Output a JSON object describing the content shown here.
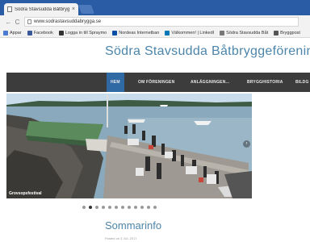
{
  "browser": {
    "tab_title": "Södra Stavsudda Båtbryg",
    "tab_close": "×",
    "url": "www.sodrastavsuddabrygga.se",
    "bookmarks": [
      {
        "label": "Appar",
        "color": "#4a7bd0"
      },
      {
        "label": "Facebook",
        "color": "#3b5998"
      },
      {
        "label": "Logga in till Spraymo",
        "color": "#333333"
      },
      {
        "label": "Nordeas Internetban",
        "color": "#0a4fa6"
      },
      {
        "label": "Välkommen! | LinkedI",
        "color": "#0077b5"
      },
      {
        "label": "Södra Stavsudda Båt",
        "color": "#777777"
      },
      {
        "label": "Bryggpost",
        "color": "#555555"
      }
    ]
  },
  "site": {
    "title": "Södra Stavsudda Båtbryggeförening",
    "nav": [
      "HEM",
      "OM FÖRENINGEN",
      "ANLÄGGNINGEN...",
      "BRYGGHISTORIA",
      "BILDG"
    ],
    "hero_caption": "Grovsopsfestival",
    "slide_count": 12,
    "active_slide": 1,
    "section_title": "Sommarinfo",
    "post_meta": "Posted on 3 JUL 2017"
  },
  "colors": {
    "accent": "#4d86aa",
    "nav_bg": "#3c3c3c",
    "nav_active": "#2f6aa4",
    "chrome_tabstrip": "#2a5ba5"
  }
}
